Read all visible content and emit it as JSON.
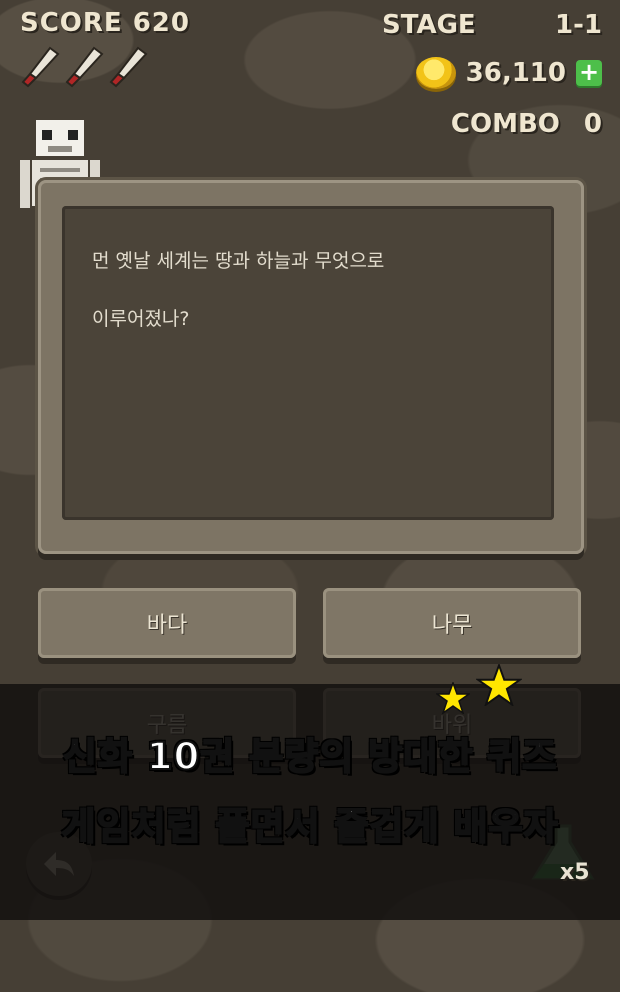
{
  "hud": {
    "score_label": "SCORE",
    "score_value": "620",
    "lives_icons": [
      "knife-icon",
      "knife-icon",
      "knife-icon"
    ],
    "stage_label": "STAGE",
    "stage_value": "1-1",
    "coins_value": "36,110",
    "add_coins_symbol": "+",
    "combo_label": "COMBO",
    "combo_value": "0"
  },
  "quiz": {
    "question_line1": "먼 옛날 세계는 땅과 하늘과 무엇으로",
    "question_line2": "이루어졌나?",
    "answers": [
      "바다",
      "나무",
      "구름",
      "바위"
    ]
  },
  "controls": {
    "back_icon": "back-arrow-icon",
    "hint_icon": "potion-icon",
    "hint_count": "x5"
  },
  "banner": {
    "line1": "신화 10권 분량의 방대한 퀴즈",
    "line2": "게임처럼 풀면서 즐겁게 배우자"
  },
  "colors": {
    "background": "#463f35",
    "board": "#7d7464",
    "text_light": "#efe6d0",
    "coin": "#f2c318",
    "plus_button": "#4dbf4a",
    "star": "#ffe600"
  }
}
